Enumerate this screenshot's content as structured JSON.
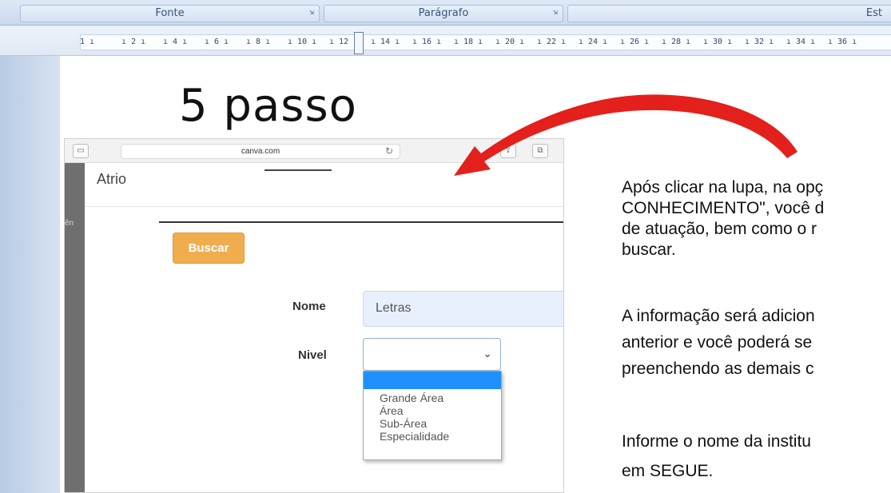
{
  "ribbon": {
    "groups": [
      {
        "label": "Fonte"
      },
      {
        "label": "Parágrafo"
      },
      {
        "label": "Est"
      }
    ]
  },
  "ruler": {
    "marks": [
      "1",
      "2",
      "4",
      "6",
      "8",
      "10",
      "12",
      "14",
      "16",
      "18",
      "20",
      "22",
      "24",
      "26",
      "28",
      "30",
      "32",
      "34",
      "36"
    ]
  },
  "document": {
    "title": "5 passo",
    "paragraphs": [
      [
        "Após clicar na lupa, na opç",
        "CONHECIMENTO\", você d",
        "de atuação, bem como o r",
        "buscar."
      ],
      [
        "A informação será adicion",
        "anterior e você poderá se",
        "preenchendo as demais c"
      ],
      [
        "Informe o nome da institu",
        "em SEGUE."
      ]
    ]
  },
  "browser": {
    "url": "canva.com",
    "side_label": "ên",
    "site_brand": "Atrio",
    "search_button": "Buscar",
    "form": {
      "nome_label": "Nome",
      "nome_value": "Letras",
      "nivel_label": "Nivel",
      "nivel_selected": "",
      "nivel_options": [
        "Grande Área",
        "Área",
        "Sub-Área",
        "Especialidade"
      ]
    }
  },
  "colors": {
    "arrow": "#e3201b",
    "buscar_button": "#f0ad4e",
    "dropdown_highlight": "#1e90ff"
  }
}
